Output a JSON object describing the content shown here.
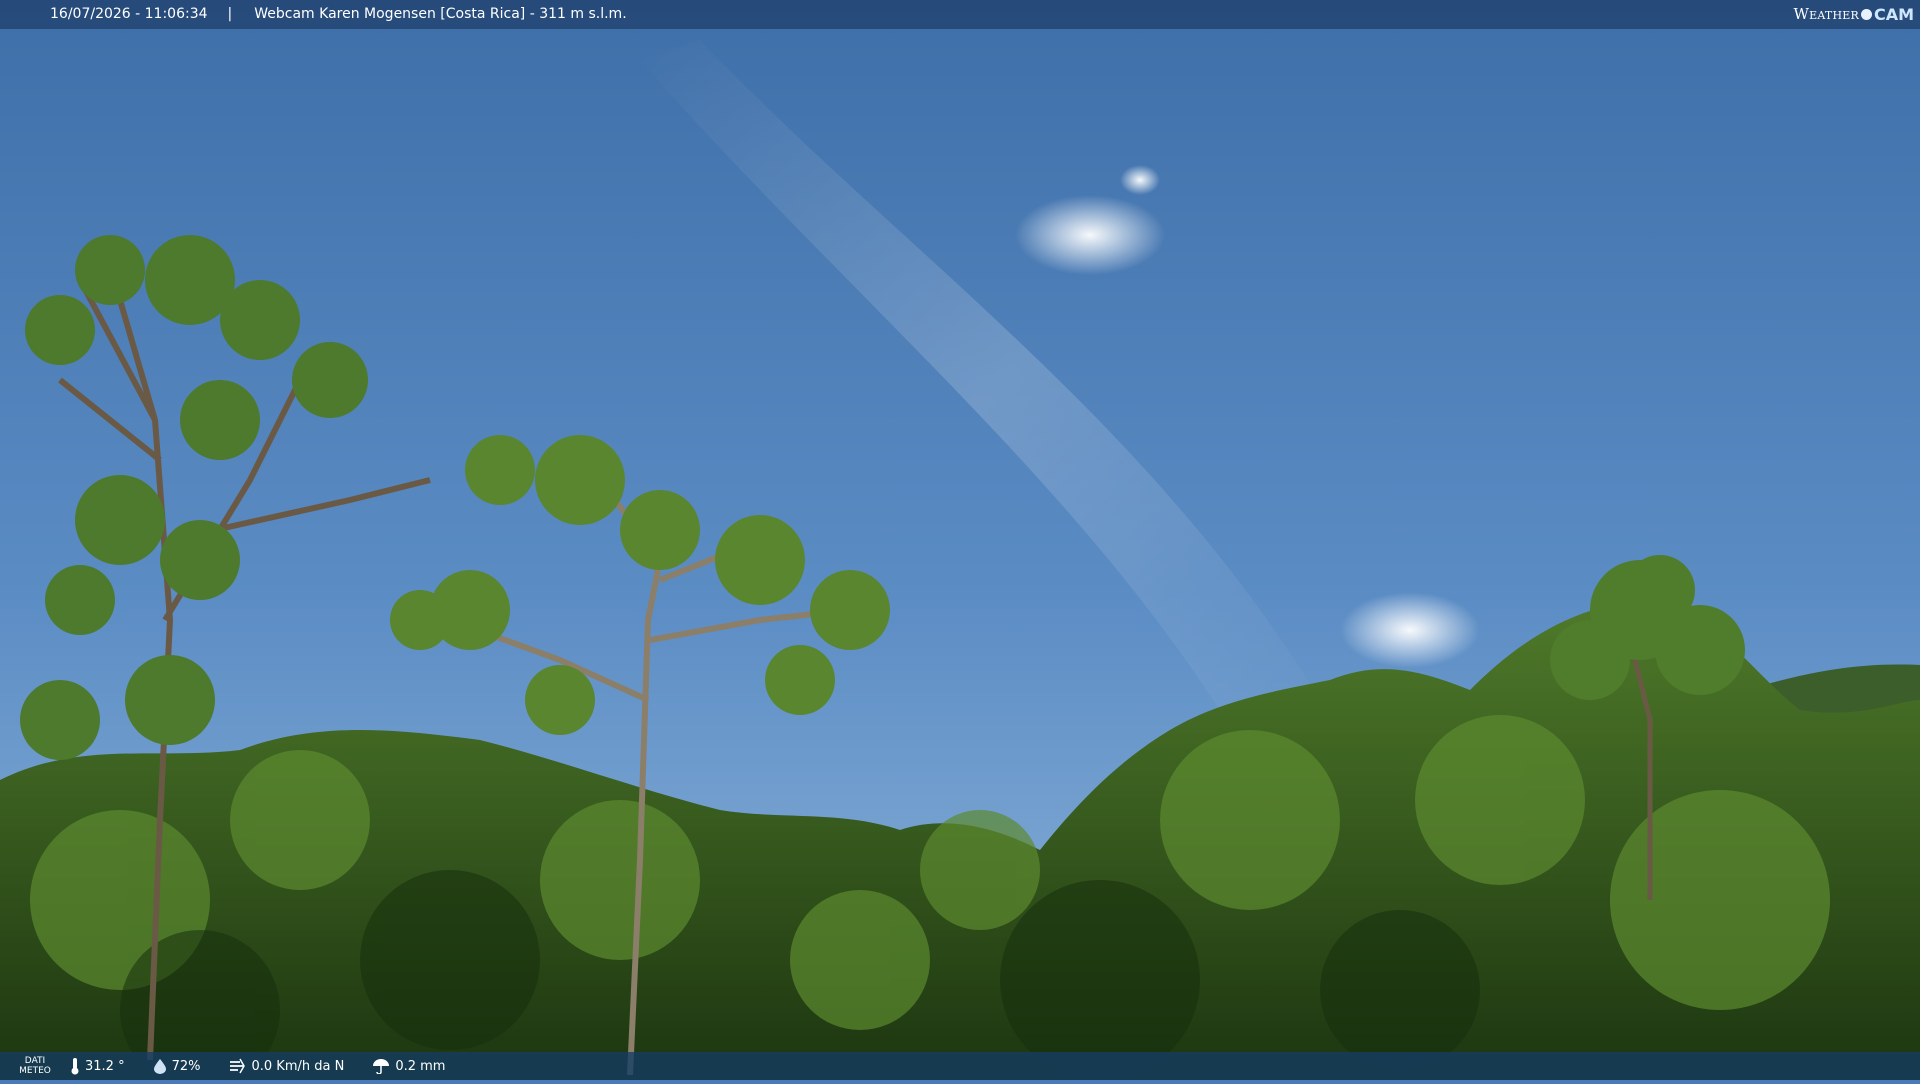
{
  "header": {
    "datetime": "16/07/2026 - 11:06:34",
    "separator": "|",
    "title": "Webcam Karen Mogensen [Costa Rica] - 311 m s.l.m.",
    "brand_prefix": "Weather",
    "brand_suffix": "CAM"
  },
  "footer": {
    "label_line1": "DATI",
    "label_line2": "METEO",
    "temperature": "31.2 °",
    "humidity": "72%",
    "wind": "0.0 Km/h da N",
    "rain": "0.2 mm"
  },
  "colors": {
    "sky_top": "#3f6fa8",
    "sky_bottom": "#8fb6dc",
    "foliage_dark": "#1f3f16",
    "foliage_light": "#6f9a3a"
  }
}
